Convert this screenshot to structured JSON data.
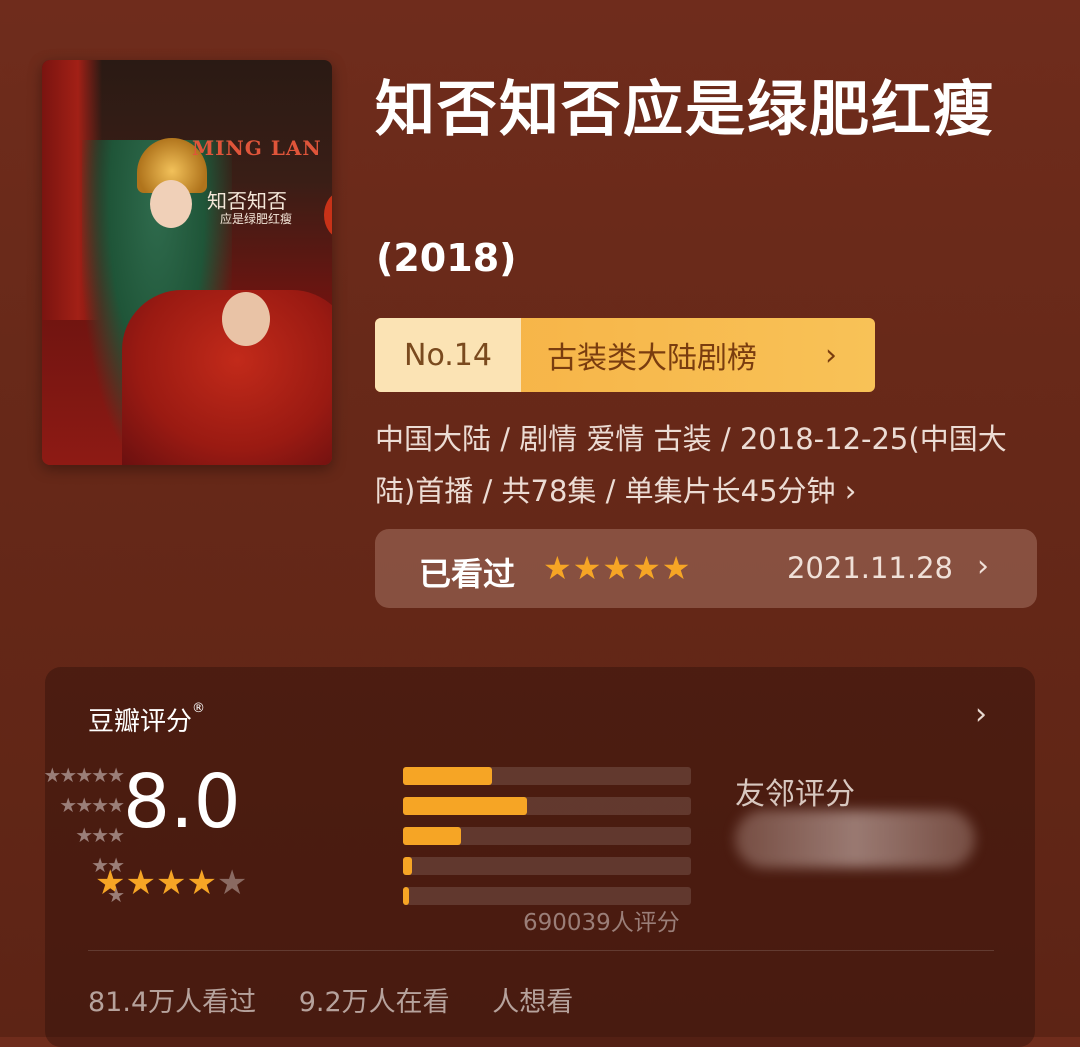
{
  "poster": {
    "title_en": "MING LAN",
    "title_cn": "知否知否",
    "subtitle_cn": "应是绿肥红瘦"
  },
  "show": {
    "title": "知否知否应是绿肥红瘦",
    "year": "(2018)"
  },
  "ranking": {
    "number": "No.14",
    "category": "古装类大陆剧榜",
    "chevron": "›"
  },
  "meta": {
    "line": "中国大陆 / 剧情 爱情 古装 / 2018-12-25(中国大陆)首播 / 共78集 / 单集片长45分钟",
    "chevron": "›"
  },
  "watched": {
    "label": "已看过",
    "stars": "★★★★★",
    "stars_value": 5,
    "date": "2021.11.28",
    "chevron": "›"
  },
  "rating": {
    "header": "豆瓣评分",
    "registered": "®",
    "chevron": "›",
    "score": "8.0",
    "stars_on": "★★★★",
    "stars_off": "★",
    "stars_value": 4,
    "distribution": [
      {
        "label": "★★★★★",
        "fraction": 0.31
      },
      {
        "label": "★★★★",
        "fraction": 0.43
      },
      {
        "label": "★★★",
        "fraction": 0.2
      },
      {
        "label": "★★",
        "fraction": 0.03
      },
      {
        "label": "★",
        "fraction": 0.02
      }
    ],
    "count": "690039人评分",
    "friends_title": "友邻评分"
  },
  "stats": {
    "watched": "81.4万人看过",
    "watching": "9.2万人在看",
    "want": "人想看"
  },
  "colors": {
    "accent": "#f6a525",
    "background": "#6a2a1a",
    "rank_bg": "#f8c257"
  }
}
